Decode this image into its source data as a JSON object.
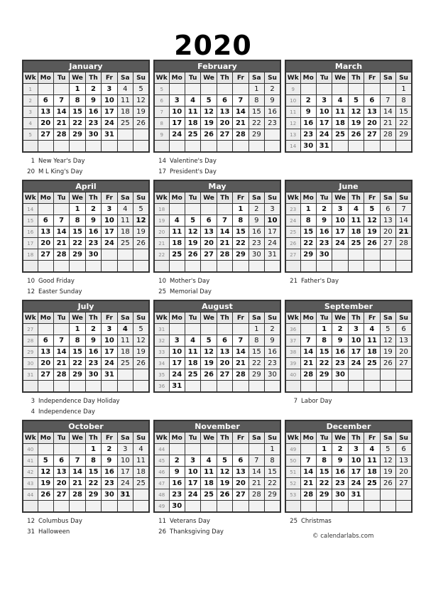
{
  "year": "2020",
  "day_headers": [
    "Wk",
    "Mo",
    "Tu",
    "We",
    "Th",
    "Fr",
    "Sa",
    "Su"
  ],
  "credit": "© calendarlabs.com",
  "colors": {
    "month_header_bg": "#595959",
    "month_header_text": "#ffffff",
    "day_header_bg": "#e6e6e6",
    "weekend_bg": "#f0f0f0",
    "border": "#333333"
  },
  "months": [
    {
      "name": "January",
      "weeks": [
        {
          "wk": "1",
          "days": [
            "",
            "",
            "1",
            "2",
            "3",
            "4",
            "5"
          ]
        },
        {
          "wk": "2",
          "days": [
            "6",
            "7",
            "8",
            "9",
            "10",
            "11",
            "12"
          ]
        },
        {
          "wk": "3",
          "days": [
            "13",
            "14",
            "15",
            "16",
            "17",
            "18",
            "19"
          ]
        },
        {
          "wk": "4",
          "days": [
            "20",
            "21",
            "22",
            "23",
            "24",
            "25",
            "26"
          ]
        },
        {
          "wk": "5",
          "days": [
            "27",
            "28",
            "29",
            "30",
            "31",
            "",
            ""
          ]
        },
        {
          "wk": "",
          "days": [
            "",
            "",
            "",
            "",
            "",
            "",
            ""
          ]
        }
      ],
      "bold_days": [
        "1",
        "20"
      ],
      "holidays": [
        {
          "day": "1",
          "name": "New Year's Day"
        },
        {
          "day": "20",
          "name": "M L King's Day"
        }
      ]
    },
    {
      "name": "February",
      "weeks": [
        {
          "wk": "5",
          "days": [
            "",
            "",
            "",
            "",
            "",
            "1",
            "2"
          ]
        },
        {
          "wk": "6",
          "days": [
            "3",
            "4",
            "5",
            "6",
            "7",
            "8",
            "9"
          ]
        },
        {
          "wk": "7",
          "days": [
            "10",
            "11",
            "12",
            "13",
            "14",
            "15",
            "16"
          ]
        },
        {
          "wk": "8",
          "days": [
            "17",
            "18",
            "19",
            "20",
            "21",
            "22",
            "23"
          ]
        },
        {
          "wk": "9",
          "days": [
            "24",
            "25",
            "26",
            "27",
            "28",
            "29",
            ""
          ]
        },
        {
          "wk": "",
          "days": [
            "",
            "",
            "",
            "",
            "",
            "",
            ""
          ]
        }
      ],
      "bold_days": [
        "14",
        "17"
      ],
      "holidays": [
        {
          "day": "14",
          "name": "Valentine's Day"
        },
        {
          "day": "17",
          "name": "President's Day"
        }
      ]
    },
    {
      "name": "March",
      "weeks": [
        {
          "wk": "9",
          "days": [
            "",
            "",
            "",
            "",
            "",
            "",
            "1"
          ]
        },
        {
          "wk": "10",
          "days": [
            "2",
            "3",
            "4",
            "5",
            "6",
            "7",
            "8"
          ]
        },
        {
          "wk": "11",
          "days": [
            "9",
            "10",
            "11",
            "12",
            "13",
            "14",
            "15"
          ]
        },
        {
          "wk": "12",
          "days": [
            "16",
            "17",
            "18",
            "19",
            "20",
            "21",
            "22"
          ]
        },
        {
          "wk": "13",
          "days": [
            "23",
            "24",
            "25",
            "26",
            "27",
            "28",
            "29"
          ]
        },
        {
          "wk": "14",
          "days": [
            "30",
            "31",
            "",
            "",
            "",
            "",
            ""
          ]
        }
      ],
      "bold_days": [],
      "holidays": []
    },
    {
      "name": "April",
      "weeks": [
        {
          "wk": "14",
          "days": [
            "",
            "",
            "1",
            "2",
            "3",
            "4",
            "5"
          ]
        },
        {
          "wk": "15",
          "days": [
            "6",
            "7",
            "8",
            "9",
            "10",
            "11",
            "12"
          ]
        },
        {
          "wk": "16",
          "days": [
            "13",
            "14",
            "15",
            "16",
            "17",
            "18",
            "19"
          ]
        },
        {
          "wk": "17",
          "days": [
            "20",
            "21",
            "22",
            "23",
            "24",
            "25",
            "26"
          ]
        },
        {
          "wk": "18",
          "days": [
            "27",
            "28",
            "29",
            "30",
            "",
            "",
            ""
          ]
        },
        {
          "wk": "",
          "days": [
            "",
            "",
            "",
            "",
            "",
            "",
            ""
          ]
        }
      ],
      "bold_days": [
        "10",
        "12"
      ],
      "holidays": [
        {
          "day": "10",
          "name": "Good Friday"
        },
        {
          "day": "12",
          "name": "Easter Sunday"
        }
      ]
    },
    {
      "name": "May",
      "weeks": [
        {
          "wk": "18",
          "days": [
            "",
            "",
            "",
            "",
            "1",
            "2",
            "3"
          ]
        },
        {
          "wk": "19",
          "days": [
            "4",
            "5",
            "6",
            "7",
            "8",
            "9",
            "10"
          ]
        },
        {
          "wk": "20",
          "days": [
            "11",
            "12",
            "13",
            "14",
            "15",
            "16",
            "17"
          ]
        },
        {
          "wk": "21",
          "days": [
            "18",
            "19",
            "20",
            "21",
            "22",
            "23",
            "24"
          ]
        },
        {
          "wk": "22",
          "days": [
            "25",
            "26",
            "27",
            "28",
            "29",
            "30",
            "31"
          ]
        },
        {
          "wk": "",
          "days": [
            "",
            "",
            "",
            "",
            "",
            "",
            ""
          ]
        }
      ],
      "bold_days": [
        "10",
        "25"
      ],
      "holidays": [
        {
          "day": "10",
          "name": "Mother's Day"
        },
        {
          "day": "25",
          "name": "Memorial Day"
        }
      ]
    },
    {
      "name": "June",
      "weeks": [
        {
          "wk": "23",
          "days": [
            "1",
            "2",
            "3",
            "4",
            "5",
            "6",
            "7"
          ]
        },
        {
          "wk": "24",
          "days": [
            "8",
            "9",
            "10",
            "11",
            "12",
            "13",
            "14"
          ]
        },
        {
          "wk": "25",
          "days": [
            "15",
            "16",
            "17",
            "18",
            "19",
            "20",
            "21"
          ]
        },
        {
          "wk": "26",
          "days": [
            "22",
            "23",
            "24",
            "25",
            "26",
            "27",
            "28"
          ]
        },
        {
          "wk": "27",
          "days": [
            "29",
            "30",
            "",
            "",
            "",
            "",
            ""
          ]
        },
        {
          "wk": "",
          "days": [
            "",
            "",
            "",
            "",
            "",
            "",
            ""
          ]
        }
      ],
      "bold_days": [
        "21"
      ],
      "holidays": [
        {
          "day": "21",
          "name": "Father's Day"
        }
      ]
    },
    {
      "name": "July",
      "weeks": [
        {
          "wk": "27",
          "days": [
            "",
            "",
            "1",
            "2",
            "3",
            "4",
            "5"
          ]
        },
        {
          "wk": "28",
          "days": [
            "6",
            "7",
            "8",
            "9",
            "10",
            "11",
            "12"
          ]
        },
        {
          "wk": "29",
          "days": [
            "13",
            "14",
            "15",
            "16",
            "17",
            "18",
            "19"
          ]
        },
        {
          "wk": "30",
          "days": [
            "20",
            "21",
            "22",
            "23",
            "24",
            "25",
            "26"
          ]
        },
        {
          "wk": "31",
          "days": [
            "27",
            "28",
            "29",
            "30",
            "31",
            "",
            ""
          ]
        },
        {
          "wk": "",
          "days": [
            "",
            "",
            "",
            "",
            "",
            "",
            ""
          ]
        }
      ],
      "bold_days": [
        "3",
        "4"
      ],
      "holidays": [
        {
          "day": "3",
          "name": "Independence Day Holiday"
        },
        {
          "day": "4",
          "name": "Independence Day"
        }
      ]
    },
    {
      "name": "August",
      "weeks": [
        {
          "wk": "31",
          "days": [
            "",
            "",
            "",
            "",
            "",
            "1",
            "2"
          ]
        },
        {
          "wk": "32",
          "days": [
            "3",
            "4",
            "5",
            "6",
            "7",
            "8",
            "9"
          ]
        },
        {
          "wk": "33",
          "days": [
            "10",
            "11",
            "12",
            "13",
            "14",
            "15",
            "16"
          ]
        },
        {
          "wk": "34",
          "days": [
            "17",
            "18",
            "19",
            "20",
            "21",
            "22",
            "23"
          ]
        },
        {
          "wk": "35",
          "days": [
            "24",
            "25",
            "26",
            "27",
            "28",
            "29",
            "30"
          ]
        },
        {
          "wk": "36",
          "days": [
            "31",
            "",
            "",
            "",
            "",
            "",
            ""
          ]
        }
      ],
      "bold_days": [],
      "holidays": []
    },
    {
      "name": "September",
      "weeks": [
        {
          "wk": "36",
          "days": [
            "",
            "1",
            "2",
            "3",
            "4",
            "5",
            "6"
          ]
        },
        {
          "wk": "37",
          "days": [
            "7",
            "8",
            "9",
            "10",
            "11",
            "12",
            "13"
          ]
        },
        {
          "wk": "38",
          "days": [
            "14",
            "15",
            "16",
            "17",
            "18",
            "19",
            "20"
          ]
        },
        {
          "wk": "39",
          "days": [
            "21",
            "22",
            "23",
            "24",
            "25",
            "26",
            "27"
          ]
        },
        {
          "wk": "40",
          "days": [
            "28",
            "29",
            "30",
            "",
            "",
            "",
            ""
          ]
        },
        {
          "wk": "",
          "days": [
            "",
            "",
            "",
            "",
            "",
            "",
            ""
          ]
        }
      ],
      "bold_days": [
        "7"
      ],
      "holidays": [
        {
          "day": "7",
          "name": "Labor Day"
        }
      ]
    },
    {
      "name": "October",
      "weeks": [
        {
          "wk": "40",
          "days": [
            "",
            "",
            "",
            "1",
            "2",
            "3",
            "4"
          ]
        },
        {
          "wk": "41",
          "days": [
            "5",
            "6",
            "7",
            "8",
            "9",
            "10",
            "11"
          ]
        },
        {
          "wk": "42",
          "days": [
            "12",
            "13",
            "14",
            "15",
            "16",
            "17",
            "18"
          ]
        },
        {
          "wk": "43",
          "days": [
            "19",
            "20",
            "21",
            "22",
            "23",
            "24",
            "25"
          ]
        },
        {
          "wk": "44",
          "days": [
            "26",
            "27",
            "28",
            "29",
            "30",
            "31",
            ""
          ]
        },
        {
          "wk": "",
          "days": [
            "",
            "",
            "",
            "",
            "",
            "",
            ""
          ]
        }
      ],
      "bold_days": [
        "12",
        "31"
      ],
      "holidays": [
        {
          "day": "12",
          "name": "Columbus Day"
        },
        {
          "day": "31",
          "name": "Halloween"
        }
      ]
    },
    {
      "name": "November",
      "weeks": [
        {
          "wk": "44",
          "days": [
            "",
            "",
            "",
            "",
            "",
            "",
            "1"
          ]
        },
        {
          "wk": "45",
          "days": [
            "2",
            "3",
            "4",
            "5",
            "6",
            "7",
            "8"
          ]
        },
        {
          "wk": "46",
          "days": [
            "9",
            "10",
            "11",
            "12",
            "13",
            "14",
            "15"
          ]
        },
        {
          "wk": "47",
          "days": [
            "16",
            "17",
            "18",
            "19",
            "20",
            "21",
            "22"
          ]
        },
        {
          "wk": "48",
          "days": [
            "23",
            "24",
            "25",
            "26",
            "27",
            "28",
            "29"
          ]
        },
        {
          "wk": "49",
          "days": [
            "30",
            "",
            "",
            "",
            "",
            "",
            ""
          ]
        }
      ],
      "bold_days": [
        "11",
        "26"
      ],
      "holidays": [
        {
          "day": "11",
          "name": "Veterans Day"
        },
        {
          "day": "26",
          "name": "Thanksgiving Day"
        }
      ]
    },
    {
      "name": "December",
      "weeks": [
        {
          "wk": "49",
          "days": [
            "",
            "1",
            "2",
            "3",
            "4",
            "5",
            "6"
          ]
        },
        {
          "wk": "50",
          "days": [
            "7",
            "8",
            "9",
            "10",
            "11",
            "12",
            "13"
          ]
        },
        {
          "wk": "51",
          "days": [
            "14",
            "15",
            "16",
            "17",
            "18",
            "19",
            "20"
          ]
        },
        {
          "wk": "52",
          "days": [
            "21",
            "22",
            "23",
            "24",
            "25",
            "26",
            "27"
          ]
        },
        {
          "wk": "53",
          "days": [
            "28",
            "29",
            "30",
            "31",
            "",
            "",
            ""
          ]
        },
        {
          "wk": "",
          "days": [
            "",
            "",
            "",
            "",
            "",
            "",
            ""
          ]
        }
      ],
      "bold_days": [
        "25"
      ],
      "holidays": [
        {
          "day": "25",
          "name": "Christmas"
        }
      ]
    }
  ]
}
